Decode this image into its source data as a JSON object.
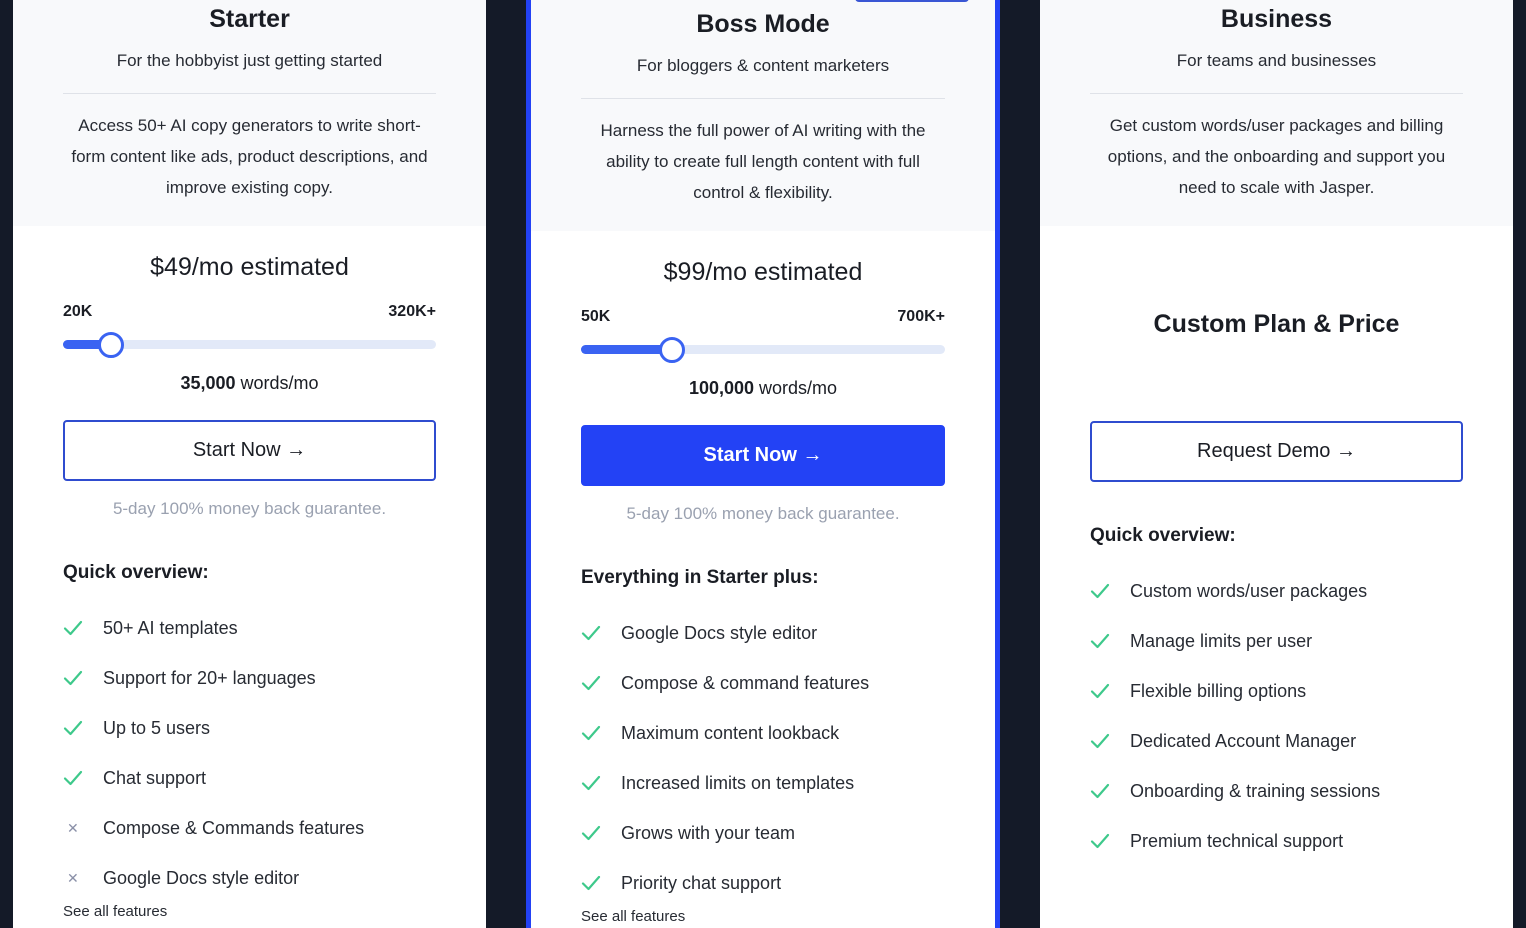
{
  "colors": {
    "background": "#141a28",
    "accent": "#2342f5",
    "check": "#3ec98b",
    "muted": "#9aa1b0"
  },
  "plans": [
    {
      "name": "Starter",
      "tagline": "For the hobbyist just getting started",
      "description": "Access 50+ AI copy generators to write short-form content like ads, product descriptions, and improve existing copy.",
      "price": "$49/mo estimated",
      "slider": {
        "min_label": "20K",
        "max_label": "320K+",
        "value_fraction": 0.13
      },
      "words_value": "35,000",
      "words_unit": " words/mo",
      "cta": "Start Now →",
      "guarantee": "5-day 100% money back guarantee.",
      "section_title": "Quick overview:",
      "features": [
        {
          "label": "50+ AI templates",
          "included": true
        },
        {
          "label": "Support for 20+ languages",
          "included": true
        },
        {
          "label": "Up to 5 users",
          "included": true
        },
        {
          "label": "Chat support",
          "included": true
        },
        {
          "label": "Compose & Commands features",
          "included": false
        },
        {
          "label": "Google Docs style editor",
          "included": false
        }
      ],
      "see_all": "See all features"
    },
    {
      "name": "Boss Mode",
      "tagline": "For bloggers & content marketers",
      "description": "Harness the full power of AI writing with the ability to create full length content with full control & flexibility.",
      "price": "$99/mo estimated",
      "slider": {
        "min_label": "50K",
        "max_label": "700K+",
        "value_fraction": 0.25
      },
      "words_value": "100,000",
      "words_unit": " words/mo",
      "cta": "Start Now →",
      "guarantee": "5-day 100% money back guarantee.",
      "section_title": "Everything in Starter plus:",
      "features": [
        {
          "label": "Google Docs style editor",
          "included": true
        },
        {
          "label": "Compose & command features",
          "included": true
        },
        {
          "label": "Maximum content lookback",
          "included": true
        },
        {
          "label": "Increased limits on templates",
          "included": true
        },
        {
          "label": "Grows with your team",
          "included": true
        },
        {
          "label": "Priority chat support",
          "included": true
        }
      ],
      "see_all": "See all features"
    },
    {
      "name": "Business",
      "tagline": "For teams and businesses",
      "description": "Get custom words/user packages and billing options, and the onboarding and support you need to scale with Jasper.",
      "custom_price": "Custom Plan & Price",
      "cta": "Request Demo →",
      "section_title": "Quick overview:",
      "features": [
        {
          "label": "Custom words/user packages",
          "included": true
        },
        {
          "label": "Manage limits per user",
          "included": true
        },
        {
          "label": "Flexible billing options",
          "included": true
        },
        {
          "label": "Dedicated Account Manager",
          "included": true
        },
        {
          "label": "Onboarding & training sessions",
          "included": true
        },
        {
          "label": "Premium technical support",
          "included": true
        }
      ]
    }
  ]
}
